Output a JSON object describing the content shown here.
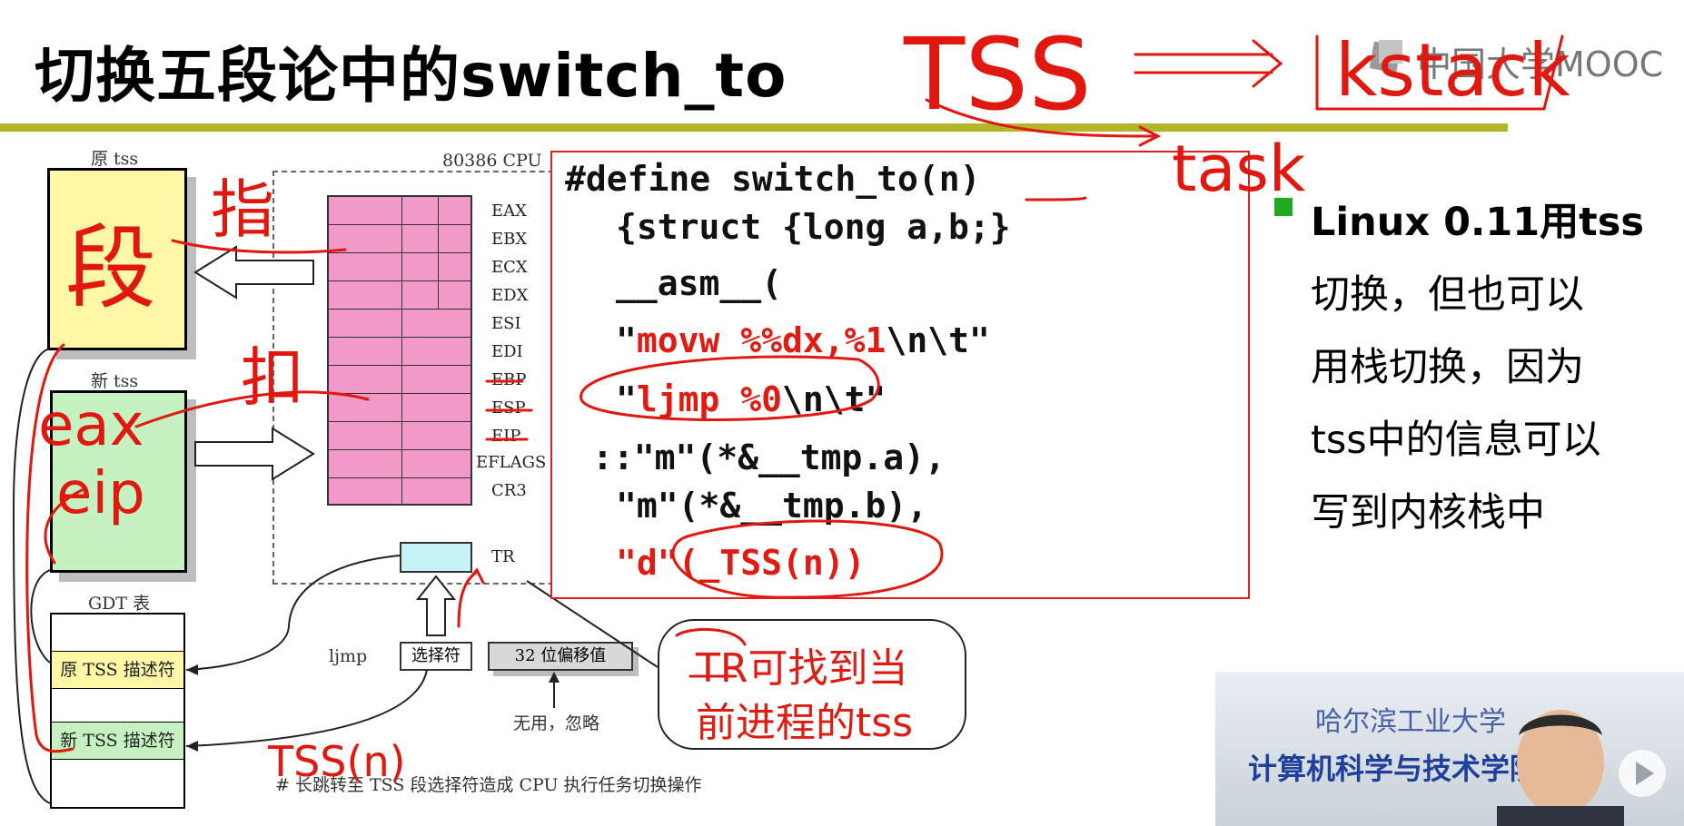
{
  "slide": {
    "title": "切换五段论中的switch_to",
    "logo": "中国大学MOOC"
  },
  "diagram": {
    "old_tss_label": "原 tss",
    "new_tss_label": "新 tss",
    "cpu_label": "80386 CPU",
    "registers": [
      "EAX",
      "EBX",
      "ECX",
      "EDX",
      "ESI",
      "EDI",
      "EBP",
      "ESP",
      "EIP",
      "EFLAGS",
      "CR3"
    ],
    "tr_label": "TR",
    "gdt_label": "GDT 表",
    "gdt_old": "原 TSS 描述符",
    "gdt_new": "新 TSS 描述符",
    "ljmp_label": "ljmp",
    "selector_label": "选择符",
    "offset_label": "32 位偏移值",
    "unused_label": "无用，忽略",
    "caption": "# 长跳转至 TSS 段选择符造成 CPU 执行任务切换操作"
  },
  "code": {
    "l1": "#define switch_to(n)",
    "l2": "{struct {long a,b;}",
    "l3": "__asm__(",
    "l4_q1": "\"",
    "l4_red": "movw %%dx,%1",
    "l4_rest": "\\n\\t\"",
    "l5_q1": "\"",
    "l5_red": "ljmp %0",
    "l5_rest": "\\n\\t\"",
    "l6": "::\"m\"(*&__tmp.a),",
    "l7": "\"m\"(*&__tmp.b),",
    "l8_red": "\"d\"(_TSS(n))"
  },
  "callout": {
    "line1": "TR可找到当",
    "line2": "前进程的tss"
  },
  "bullet": {
    "line1": "Linux 0.11用tss",
    "line2": "切换，但也可以",
    "line3": "用栈切换，因为",
    "line4": "tss中的信息可以",
    "line5": "写到内核栈中"
  },
  "annotations": {
    "tss": "TSS",
    "kstack": "kstack",
    "task": "task",
    "duan": "段",
    "zhi": "指",
    "kou": "扣",
    "eax": "eax",
    "eip": "eip",
    "tss_n": "TSS(n)"
  },
  "video": {
    "banner1": "哈尔滨工业大学",
    "banner2": "计算机科学与技术学院"
  },
  "colors": {
    "accent_rule": "#b5b52a",
    "ink_red": "#e01b12",
    "bullet_green": "#1faa1f",
    "old_tss_fill": "#fdf7a6",
    "new_tss_fill": "#c5f2c0",
    "register_fill": "#f29ac7"
  }
}
